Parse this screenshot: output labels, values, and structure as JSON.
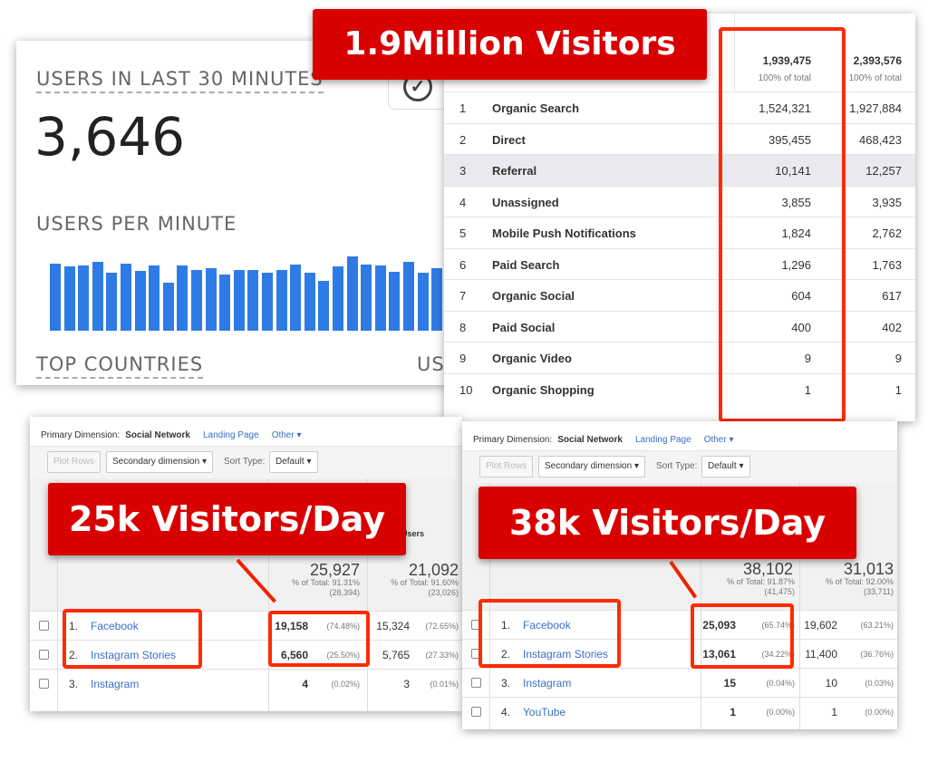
{
  "realtime": {
    "users_last_30_label": "USERS IN LAST 30 MINUTES",
    "users_last_30_value": "3,646",
    "users_per_minute_label": "USERS PER MINUTE",
    "top_countries_label": "TOP COUNTRIES",
    "partial_label": "US",
    "check_icon": "check-circle-icon",
    "bar_color": "#2f7be6"
  },
  "chart_data": {
    "type": "bar",
    "title": "USERS PER MINUTE",
    "values": [
      70,
      67,
      68,
      72,
      60,
      70,
      62,
      68,
      50,
      68,
      63,
      65,
      58,
      63,
      63,
      60,
      63,
      69,
      60,
      52,
      67,
      77,
      69,
      68,
      61,
      72,
      60,
      65
    ],
    "xlabel": "",
    "ylabel": ""
  },
  "channels": {
    "total1": "1,939,475",
    "total1_sub": "100% of total",
    "total2": "2,393,576",
    "total2_sub": "100% of total",
    "rows": [
      {
        "i": "1",
        "name": "Organic Search",
        "v1": "1,524,321",
        "v2": "1,927,884"
      },
      {
        "i": "2",
        "name": "Direct",
        "v1": "395,455",
        "v2": "468,423"
      },
      {
        "i": "3",
        "name": "Referral",
        "v1": "10,141",
        "v2": "12,257"
      },
      {
        "i": "4",
        "name": "Unassigned",
        "v1": "3,855",
        "v2": "3,935"
      },
      {
        "i": "5",
        "name": "Mobile Push Notifications",
        "v1": "1,824",
        "v2": "2,762"
      },
      {
        "i": "6",
        "name": "Paid Search",
        "v1": "1,296",
        "v2": "1,763"
      },
      {
        "i": "7",
        "name": "Organic Social",
        "v1": "604",
        "v2": "617"
      },
      {
        "i": "8",
        "name": "Paid Social",
        "v1": "400",
        "v2": "402"
      },
      {
        "i": "9",
        "name": "Organic Video",
        "v1": "9",
        "v2": "9"
      },
      {
        "i": "10",
        "name": "Organic Shopping",
        "v1": "1",
        "v2": "1"
      }
    ]
  },
  "labels": {
    "million": "1.9Million Visitors",
    "left": "25k Visitors/Day",
    "right": "38k Visitors/Day",
    "accent": "#d90000"
  },
  "ga_common": {
    "primary_dimension": "Primary Dimension:",
    "social_network": "Social Network",
    "landing_page": "Landing Page",
    "other": "Other",
    "plot_rows": "Plot Rows",
    "secondary_dimension": "Secondary dimension",
    "sort_type": "Sort Type:",
    "default": "Default",
    "users_header": "Users"
  },
  "ga_left": {
    "total1": "25,927",
    "total1_pct": "% of Total: 91.31%",
    "total1_abs": "(28,394)",
    "total2": "21,092",
    "total2_pct": "% of Total: 91.60%",
    "total2_abs": "(23,026)",
    "rows": [
      {
        "i": "1.",
        "name": "Facebook",
        "v1": "19,158",
        "p1": "(74.48%)",
        "v2": "15,324",
        "p2": "(72.65%)"
      },
      {
        "i": "2.",
        "name": "Instagram Stories",
        "v1": "6,560",
        "p1": "(25.50%)",
        "v2": "5,765",
        "p2": "(27.33%)"
      },
      {
        "i": "3.",
        "name": "Instagram",
        "v1": "4",
        "p1": "(0.02%)",
        "v2": "3",
        "p2": "(0.01%)"
      }
    ]
  },
  "ga_right": {
    "total1": "38,102",
    "total1_pct": "% of Total: 91.87%",
    "total1_abs": "(41,475)",
    "total2": "31,013",
    "total2_pct": "% of Total: 92.00%",
    "total2_abs": "(33,711)",
    "rows": [
      {
        "i": "1.",
        "name": "Facebook",
        "v1": "25,093",
        "p1": "(65.74%)",
        "v2": "19,602",
        "p2": "(63.21%)"
      },
      {
        "i": "2.",
        "name": "Instagram Stories",
        "v1": "13,061",
        "p1": "(34.22%)",
        "v2": "11,400",
        "p2": "(36.76%)"
      },
      {
        "i": "3.",
        "name": "Instagram",
        "v1": "15",
        "p1": "(0.04%)",
        "v2": "10",
        "p2": "(0.03%)"
      },
      {
        "i": "4.",
        "name": "YouTube",
        "v1": "1",
        "p1": "(0.00%)",
        "v2": "1",
        "p2": "(0.00%)"
      }
    ]
  }
}
